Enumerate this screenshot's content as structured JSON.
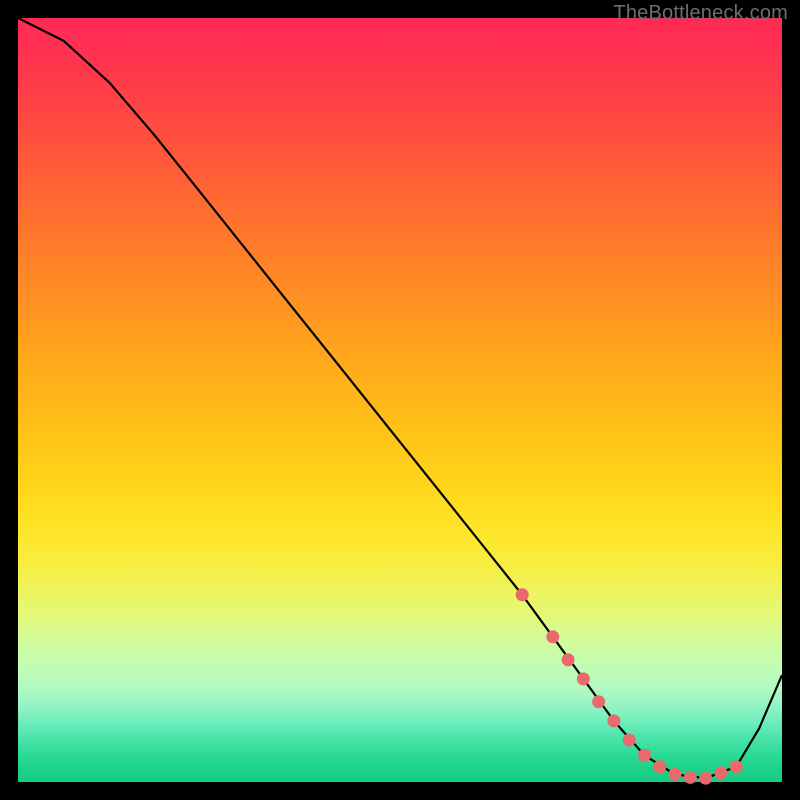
{
  "watermark": "TheBottleneck.com",
  "colors": {
    "background": "#000000",
    "curve_stroke": "#000000",
    "dot_fill": "#e96a6d"
  },
  "chart_data": {
    "type": "line",
    "title": "",
    "xlabel": "",
    "ylabel": "",
    "xlim": [
      0,
      100
    ],
    "ylim": [
      0,
      100
    ],
    "series": [
      {
        "name": "bottleneck-curve",
        "x": [
          0,
          6,
          12,
          18,
          24,
          30,
          36,
          42,
          48,
          54,
          60,
          66,
          70,
          74,
          78,
          82,
          86,
          90,
          94,
          97,
          100
        ],
        "values": [
          100,
          97,
          91.5,
          84.5,
          77,
          69.5,
          62,
          54.5,
          47,
          39.5,
          32,
          24.5,
          19,
          13.5,
          8,
          3.5,
          1,
          0.5,
          2,
          7,
          14
        ]
      }
    ],
    "dots": {
      "name": "highlight-points",
      "x": [
        66,
        70,
        72,
        74,
        76,
        78,
        80,
        82,
        84,
        86,
        88,
        90,
        92,
        94
      ],
      "values": [
        24.5,
        19,
        16,
        13.5,
        10.5,
        8,
        5.5,
        3.5,
        2,
        1,
        0.6,
        0.5,
        1.2,
        2
      ]
    }
  }
}
